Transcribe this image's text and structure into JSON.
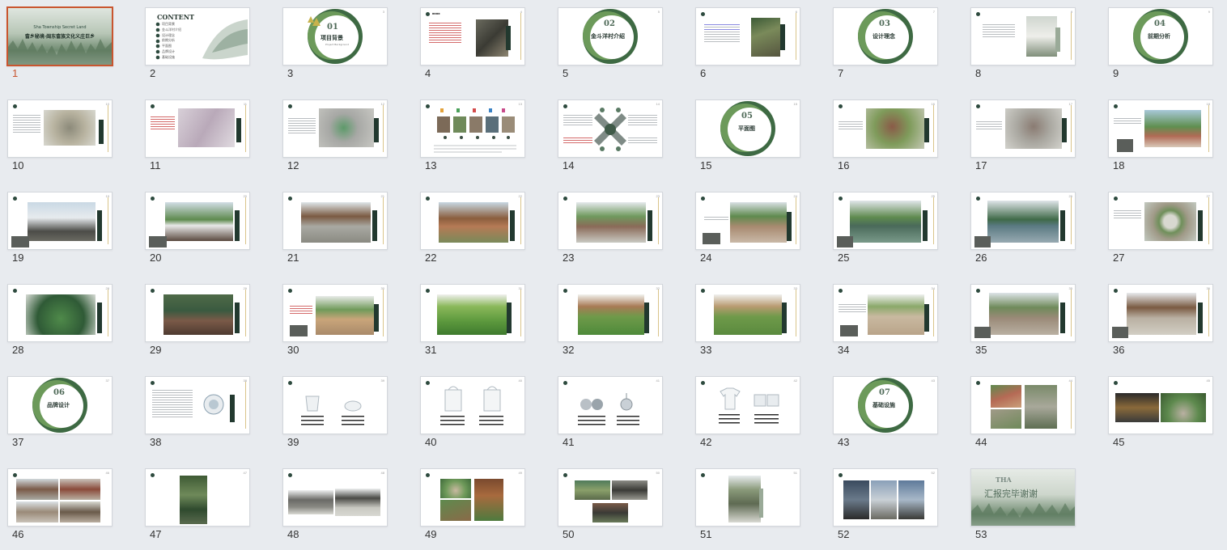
{
  "cover": {
    "title_en": "Sha Township Secret Land",
    "title_cn": "畲乡秘境·闽东畲族文化义庄巨乡"
  },
  "content": {
    "heading": "CONTENT",
    "items": [
      "项目背景",
      "金斗洋村介绍",
      "设计理念",
      "前期分析",
      "平面图",
      "品牌设计",
      "基础设施"
    ]
  },
  "sections": {
    "s01": {
      "num": "01",
      "title": "项目背景",
      "sub": "Project Background"
    },
    "s02": {
      "num": "02",
      "title": "金斗洋村介绍"
    },
    "s03": {
      "num": "03",
      "title": "设计理念"
    },
    "s04": {
      "num": "04",
      "title": "前期分析"
    },
    "s05": {
      "num": "05",
      "title": "平面图"
    },
    "s06": {
      "num": "06",
      "title": "品牌设计"
    },
    "s07": {
      "num": "07",
      "title": "基础设施"
    }
  },
  "ending": {
    "brand": "THA",
    "text": "汇报完毕谢谢"
  },
  "colors": {
    "accent_selected": "#c9552f",
    "forest_dark": "#22392f",
    "forest_mid": "#4f7a52",
    "sage": "#9aaa98"
  },
  "slides": [
    {
      "num": "1"
    },
    {
      "num": "2"
    },
    {
      "num": "3"
    },
    {
      "num": "4"
    },
    {
      "num": "5"
    },
    {
      "num": "6"
    },
    {
      "num": "7"
    },
    {
      "num": "8"
    },
    {
      "num": "9"
    },
    {
      "num": "10"
    },
    {
      "num": "11"
    },
    {
      "num": "12"
    },
    {
      "num": "13"
    },
    {
      "num": "14"
    },
    {
      "num": "15"
    },
    {
      "num": "16"
    },
    {
      "num": "17"
    },
    {
      "num": "18"
    },
    {
      "num": "19"
    },
    {
      "num": "20"
    },
    {
      "num": "21"
    },
    {
      "num": "22"
    },
    {
      "num": "23"
    },
    {
      "num": "24"
    },
    {
      "num": "25"
    },
    {
      "num": "26"
    },
    {
      "num": "27"
    },
    {
      "num": "28"
    },
    {
      "num": "29"
    },
    {
      "num": "30"
    },
    {
      "num": "31"
    },
    {
      "num": "32"
    },
    {
      "num": "33"
    },
    {
      "num": "34"
    },
    {
      "num": "35"
    },
    {
      "num": "36"
    },
    {
      "num": "37"
    },
    {
      "num": "38"
    },
    {
      "num": "39"
    },
    {
      "num": "40"
    },
    {
      "num": "41"
    },
    {
      "num": "42"
    },
    {
      "num": "43"
    },
    {
      "num": "44"
    },
    {
      "num": "45"
    },
    {
      "num": "46"
    },
    {
      "num": "47"
    },
    {
      "num": "48"
    },
    {
      "num": "49"
    },
    {
      "num": "50"
    },
    {
      "num": "51"
    },
    {
      "num": "52"
    },
    {
      "num": "53"
    }
  ],
  "selected_slide": "1"
}
